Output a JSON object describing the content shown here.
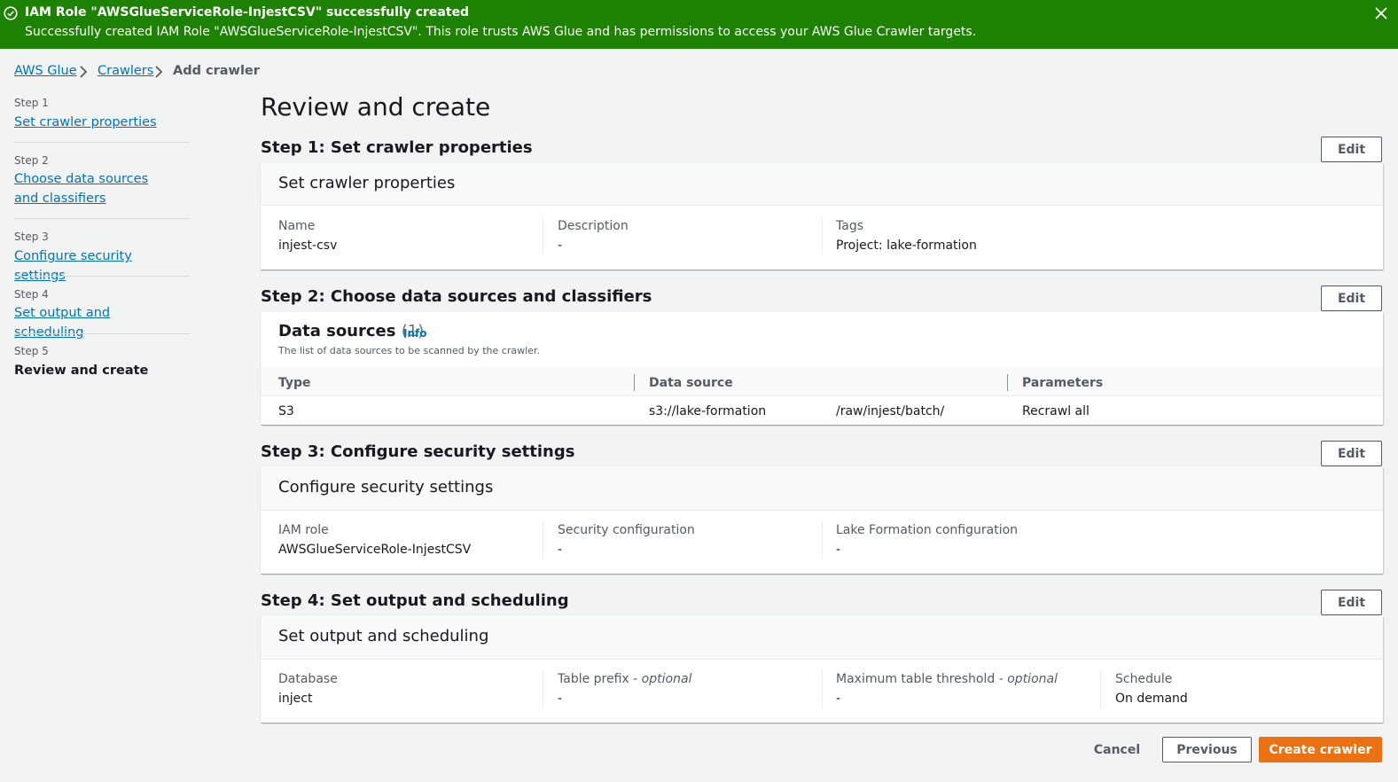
{
  "flash": {
    "type": "success",
    "icon": "check-circle-icon",
    "title": "IAM Role \"AWSGlueServiceRole-InjestCSV\" successfully created",
    "message": "Successfully created IAM Role \"AWSGlueServiceRole-InjestCSV\". This role trusts AWS Glue and has permissions to access your AWS Glue Crawler targets.",
    "color": "#1d8102"
  },
  "breadcrumb": {
    "items": [
      "AWS Glue",
      "Crawlers",
      "Add crawler"
    ]
  },
  "nav": {
    "steps": [
      {
        "step": "Step 1",
        "label": "Set crawler properties"
      },
      {
        "step": "Step 2",
        "label": "Choose data sources and classifiers"
      },
      {
        "step": "Step 3",
        "label": "Configure security settings"
      },
      {
        "step": "Step 4",
        "label": "Set output and scheduling"
      },
      {
        "step": "Step 5",
        "label": "Review and create"
      }
    ]
  },
  "page": {
    "title": "Review and create"
  },
  "edit_label": "Edit",
  "step1": {
    "heading": "Step 1: Set crawler properties",
    "card_title": "Set crawler properties",
    "fields": [
      {
        "label": "Name",
        "value": "injest-csv"
      },
      {
        "label": "Description",
        "value": "-"
      },
      {
        "label": "Tags",
        "value": "Project: lake-formation"
      }
    ]
  },
  "step2": {
    "heading": "Step 2: Choose data sources and classifiers",
    "title": "Data sources",
    "count": "(1)",
    "info": "Info",
    "description": "The list of data sources to be scanned by the crawler.",
    "columns": [
      "Type",
      "Data source",
      "Parameters"
    ],
    "rows": [
      {
        "type": "S3",
        "source_bucket": "s3://lake-formation",
        "source_path": "/raw/injest/batch/",
        "parameters": "Recrawl all"
      }
    ]
  },
  "step3": {
    "heading": "Step 3: Configure security settings",
    "card_title": "Configure security settings",
    "fields": [
      {
        "label": "IAM role",
        "value": "AWSGlueServiceRole-InjestCSV"
      },
      {
        "label": "Security configuration",
        "value": "-"
      },
      {
        "label": "Lake Formation configuration",
        "value": "-"
      }
    ]
  },
  "step4": {
    "heading": "Step 4: Set output and scheduling",
    "card_title": "Set output and scheduling",
    "optional": "optional",
    "fields": [
      {
        "label": "Database",
        "value": "inject"
      },
      {
        "label": "Table prefix",
        "value": "-"
      },
      {
        "label": "Maximum table threshold",
        "value": "-"
      },
      {
        "label": "Schedule",
        "value": "On demand"
      }
    ]
  },
  "actions": {
    "cancel": "Cancel",
    "previous": "Previous",
    "create": "Create crawler",
    "primary_color": "#ec7211"
  }
}
